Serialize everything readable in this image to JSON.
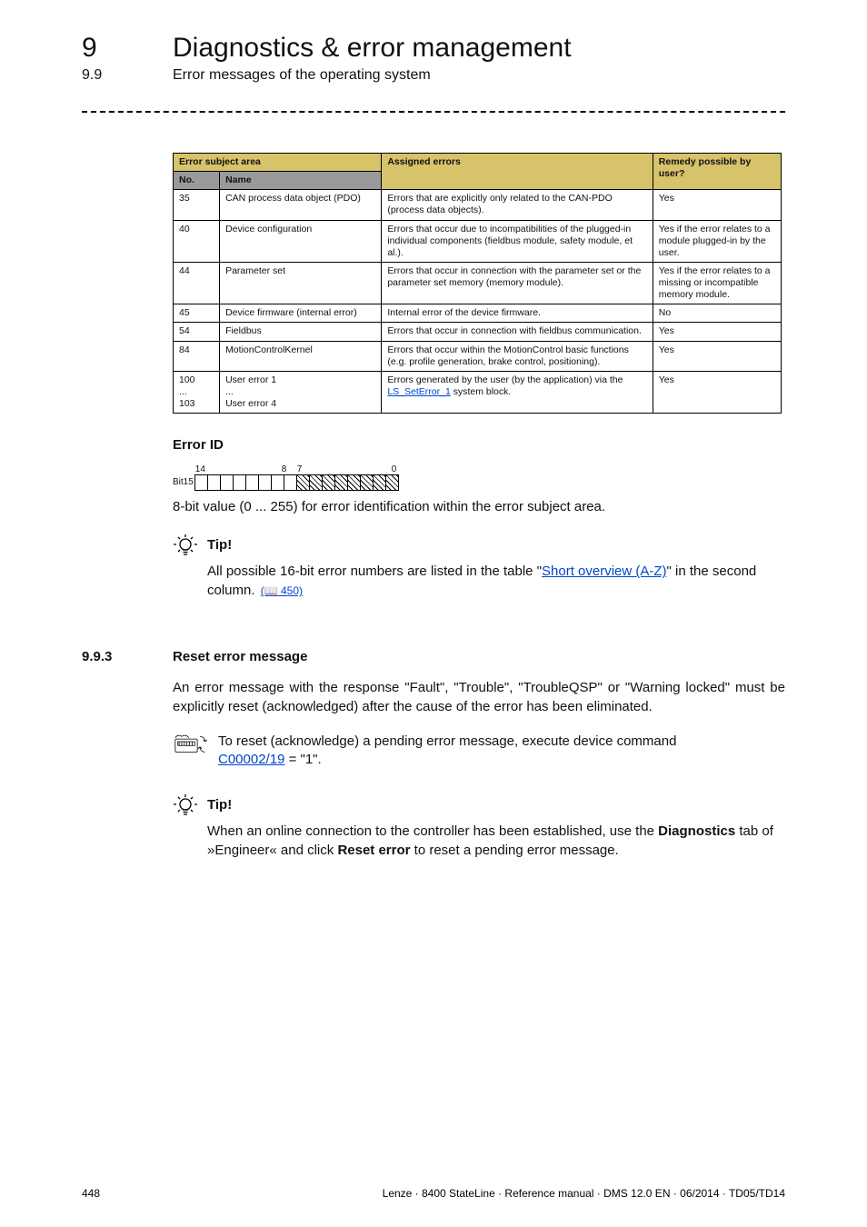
{
  "header": {
    "chapter_num": "9",
    "chapter_title": "Diagnostics & error management",
    "section_num": "9.9",
    "section_title": "Error messages of the operating system"
  },
  "table": {
    "head_subject": "Error subject area",
    "head_no": "No.",
    "head_name": "Name",
    "head_assigned": "Assigned errors",
    "head_remedy": "Remedy possible by user?",
    "rows": [
      {
        "no": "35",
        "name": "CAN process data object (PDO)",
        "assigned": "Errors that are explicitly only related to the CAN-PDO (process data objects).",
        "remedy": "Yes"
      },
      {
        "no": "40",
        "name": "Device configuration",
        "assigned": "Errors that occur due to incompatibilities of the plugged-in individual components (fieldbus module, safety module, et al.).",
        "remedy": "Yes if the error relates to a module plugged-in by the user."
      },
      {
        "no": "44",
        "name": "Parameter set",
        "assigned": "Errors that occur in connection with the parameter set or the parameter set memory (memory module).",
        "remedy": "Yes if the error relates to a missing or incompatible memory module."
      },
      {
        "no": "45",
        "name": "Device firmware (internal error)",
        "assigned": "Internal error of the device firmware.",
        "remedy": "No"
      },
      {
        "no": "54",
        "name": "Fieldbus",
        "assigned": "Errors that occur in connection with fieldbus communication.",
        "remedy": "Yes"
      },
      {
        "no": "84",
        "name": "MotionControlKernel",
        "assigned": "Errors that occur within the MotionControl basic functions (e.g. profile generation, brake control, positioning).",
        "remedy": "Yes"
      },
      {
        "no": "100\n...\n103",
        "name": "User error 1\n...\nUser error 4",
        "assigned_pre": "Errors generated by the user (by the application) via the ",
        "assigned_link": "LS_SetError_1",
        "assigned_post": " system block.",
        "remedy": "Yes"
      }
    ]
  },
  "error_id": {
    "heading": "Error ID",
    "bit_left": "Bit15",
    "bit_14": "14",
    "bit_8": "8",
    "bit_7": "7",
    "bit_0": "0",
    "desc": "8-bit value (0 ... 255) for error identification within the error subject area."
  },
  "tip1": {
    "label": "Tip!",
    "body_pre": "All possible 16-bit error numbers are listed in the table \"",
    "body_link": "Short overview (A-Z)",
    "body_post": "\" in the second column. ",
    "page_ref": "(📖 450)"
  },
  "sec993": {
    "num": "9.9.3",
    "title": "Reset error message",
    "para": "An error message with the response \"Fault\", \"Trouble\", \"TroubleQSP\" or \"Warning locked\" must be explicitly reset (acknowledged) after the cause of the error has been eliminated."
  },
  "howto": {
    "text_pre": "To reset (acknowledge) a pending error message, execute device command ",
    "link": "C00002/19",
    "text_post": " = \"1\"."
  },
  "tip2": {
    "label": "Tip!",
    "body_pre": "When an online connection to the controller has been established, use the ",
    "bold1": "Diagnostics",
    "body_mid": " tab of »Engineer« and click ",
    "bold2": "Reset error",
    "body_post": " to reset a pending error message."
  },
  "footer": {
    "page": "448",
    "meta": "Lenze · 8400 StateLine · Reference manual · DMS 12.0 EN · 06/2014 · TD05/TD14"
  }
}
